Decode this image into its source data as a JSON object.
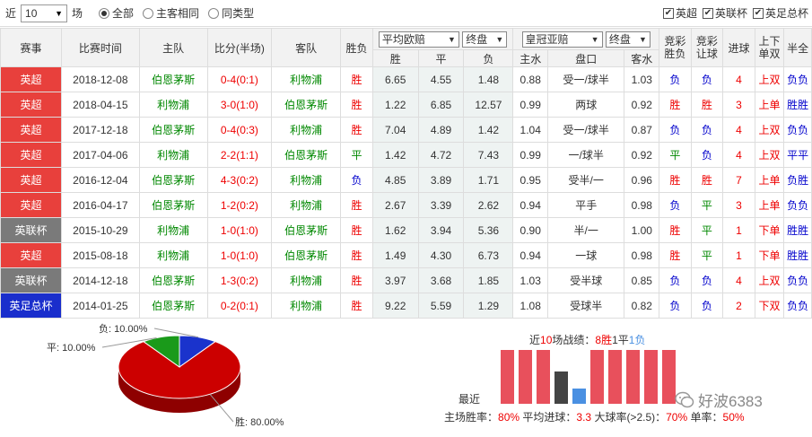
{
  "filter": {
    "prefix": "近",
    "count": "10",
    "suffix": "场",
    "radios": [
      {
        "label": "全部",
        "checked": true
      },
      {
        "label": "主客相同",
        "checked": false
      },
      {
        "label": "同类型",
        "checked": false
      }
    ],
    "checks": [
      {
        "label": "英超",
        "checked": true
      },
      {
        "label": "英联杯",
        "checked": true
      },
      {
        "label": "英足总杯",
        "checked": true
      }
    ],
    "check_mark": "✔"
  },
  "headers": {
    "league": "赛事",
    "time": "比赛时间",
    "home": "主队",
    "score": "比分(半场)",
    "away": "客队",
    "result": "胜负",
    "odds_select": "平均欧赔",
    "odds_type_select": "终盘",
    "asia_select": "皇冠亚赔",
    "asia_type_select": "终盘",
    "lottery_wl": "竞彩胜负",
    "lottery_hc": "竞彩让球",
    "goals": "进球",
    "updown": "上下单双",
    "half": "半全",
    "sub": {
      "win": "胜",
      "draw": "平",
      "lose": "负",
      "home_water": "主水",
      "handicap": "盘口",
      "away_water": "客水"
    }
  },
  "rows": [
    {
      "league": "英超",
      "league_color": "#e8403c",
      "date": "2018-12-08",
      "home": "伯恩茅斯",
      "home_color": "green",
      "score": "0-4(0:1)",
      "away": "利物浦",
      "away_color": "green",
      "result": "胜",
      "result_color": "red",
      "w": "6.65",
      "d": "4.55",
      "l": "1.48",
      "hw": "0.88",
      "hc": "受一/球半",
      "aw": "1.03",
      "lwl": "负",
      "lwl_color": "blue",
      "lhc": "负",
      "lhc_color": "blue",
      "goals": "4",
      "ud": "上双",
      "half": "负负",
      "half_color": "blue"
    },
    {
      "league": "英超",
      "league_color": "#e8403c",
      "date": "2018-04-15",
      "home": "利物浦",
      "home_color": "green",
      "score": "3-0(1:0)",
      "away": "伯恩茅斯",
      "away_color": "green",
      "result": "胜",
      "result_color": "red",
      "w": "1.22",
      "d": "6.85",
      "l": "12.57",
      "hw": "0.99",
      "hc": "两球",
      "aw": "0.92",
      "lwl": "胜",
      "lwl_color": "red",
      "lhc": "胜",
      "lhc_color": "red",
      "goals": "3",
      "ud": "上单",
      "half": "胜胜",
      "half_color": "blue"
    },
    {
      "league": "英超",
      "league_color": "#e8403c",
      "date": "2017-12-18",
      "home": "伯恩茅斯",
      "home_color": "green",
      "score": "0-4(0:3)",
      "away": "利物浦",
      "away_color": "green",
      "result": "胜",
      "result_color": "red",
      "w": "7.04",
      "d": "4.89",
      "l": "1.42",
      "hw": "1.04",
      "hc": "受一/球半",
      "aw": "0.87",
      "lwl": "负",
      "lwl_color": "blue",
      "lhc": "负",
      "lhc_color": "blue",
      "goals": "4",
      "ud": "上双",
      "half": "负负",
      "half_color": "blue"
    },
    {
      "league": "英超",
      "league_color": "#e8403c",
      "date": "2017-04-06",
      "home": "利物浦",
      "home_color": "green",
      "score": "2-2(1:1)",
      "away": "伯恩茅斯",
      "away_color": "green",
      "result": "平",
      "result_color": "green",
      "w": "1.42",
      "d": "4.72",
      "l": "7.43",
      "hw": "0.99",
      "hc": "一/球半",
      "aw": "0.92",
      "lwl": "平",
      "lwl_color": "green",
      "lhc": "负",
      "lhc_color": "blue",
      "goals": "4",
      "ud": "上双",
      "half": "平平",
      "half_color": "blue"
    },
    {
      "league": "英超",
      "league_color": "#e8403c",
      "date": "2016-12-04",
      "home": "伯恩茅斯",
      "home_color": "green",
      "score": "4-3(0:2)",
      "away": "利物浦",
      "away_color": "green",
      "result": "负",
      "result_color": "blue",
      "w": "4.85",
      "d": "3.89",
      "l": "1.71",
      "hw": "0.95",
      "hc": "受半/一",
      "aw": "0.96",
      "lwl": "胜",
      "lwl_color": "red",
      "lhc": "胜",
      "lhc_color": "red",
      "goals": "7",
      "ud": "上单",
      "half": "负胜",
      "half_color": "blue"
    },
    {
      "league": "英超",
      "league_color": "#e8403c",
      "date": "2016-04-17",
      "home": "伯恩茅斯",
      "home_color": "green",
      "score": "1-2(0:2)",
      "away": "利物浦",
      "away_color": "green",
      "result": "胜",
      "result_color": "red",
      "w": "2.67",
      "d": "3.39",
      "l": "2.62",
      "hw": "0.94",
      "hc": "平手",
      "aw": "0.98",
      "lwl": "负",
      "lwl_color": "blue",
      "lhc": "平",
      "lhc_color": "green",
      "goals": "3",
      "ud": "上单",
      "half": "负负",
      "half_color": "blue"
    },
    {
      "league": "英联杯",
      "league_color": "#7a7a7a",
      "date": "2015-10-29",
      "home": "利物浦",
      "home_color": "green",
      "score": "1-0(1:0)",
      "away": "伯恩茅斯",
      "away_color": "green",
      "result": "胜",
      "result_color": "red",
      "w": "1.62",
      "d": "3.94",
      "l": "5.36",
      "hw": "0.90",
      "hc": "半/一",
      "aw": "1.00",
      "lwl": "胜",
      "lwl_color": "red",
      "lhc": "平",
      "lhc_color": "green",
      "goals": "1",
      "ud": "下单",
      "half": "胜胜",
      "half_color": "blue"
    },
    {
      "league": "英超",
      "league_color": "#e8403c",
      "date": "2015-08-18",
      "home": "利物浦",
      "home_color": "green",
      "score": "1-0(1:0)",
      "away": "伯恩茅斯",
      "away_color": "green",
      "result": "胜",
      "result_color": "red",
      "w": "1.49",
      "d": "4.30",
      "l": "6.73",
      "hw": "0.94",
      "hc": "一球",
      "aw": "0.98",
      "lwl": "胜",
      "lwl_color": "red",
      "lhc": "平",
      "lhc_color": "green",
      "goals": "1",
      "ud": "下单",
      "half": "胜胜",
      "half_color": "blue"
    },
    {
      "league": "英联杯",
      "league_color": "#7a7a7a",
      "date": "2014-12-18",
      "home": "伯恩茅斯",
      "home_color": "green",
      "score": "1-3(0:2)",
      "away": "利物浦",
      "away_color": "green",
      "result": "胜",
      "result_color": "red",
      "w": "3.97",
      "d": "3.68",
      "l": "1.85",
      "hw": "1.03",
      "hc": "受半球",
      "aw": "0.85",
      "lwl": "负",
      "lwl_color": "blue",
      "lhc": "负",
      "lhc_color": "blue",
      "goals": "4",
      "ud": "上双",
      "half": "负负",
      "half_color": "blue"
    },
    {
      "league": "英足总杯",
      "league_color": "#1a2ecc",
      "date": "2014-01-25",
      "home": "伯恩茅斯",
      "home_color": "green",
      "score": "0-2(0:1)",
      "away": "利物浦",
      "away_color": "green",
      "result": "胜",
      "result_color": "red",
      "w": "9.22",
      "d": "5.59",
      "l": "1.29",
      "hw": "1.08",
      "hc": "受球半",
      "aw": "0.82",
      "lwl": "负",
      "lwl_color": "blue",
      "lhc": "负",
      "lhc_color": "blue",
      "goals": "2",
      "ud": "下双",
      "half": "负负",
      "half_color": "blue"
    }
  ],
  "pie": {
    "labels": [
      {
        "text": "负: 10.00%"
      },
      {
        "text": "平: 10.00%"
      },
      {
        "text": "胜: 80.00%"
      }
    ],
    "chart_data": {
      "type": "pie",
      "slices": [
        {
          "name": "胜",
          "value": 80,
          "color": "#cc0000"
        },
        {
          "name": "负",
          "value": 10,
          "color": "#1a33cc"
        },
        {
          "name": "平",
          "value": 10,
          "color": "#1a9a1a"
        }
      ]
    }
  },
  "stats": {
    "title_prefix": "近",
    "title_count": "10",
    "title_mid": "场战绩：",
    "wins": "8胜",
    "draws": "1平",
    "losses": "1负",
    "recent_label": "最近",
    "bars": [
      {
        "result": "win",
        "color": "#e8505c"
      },
      {
        "result": "win",
        "color": "#e8505c"
      },
      {
        "result": "win",
        "color": "#e8505c"
      },
      {
        "result": "draw",
        "color": "#444444"
      },
      {
        "result": "loss",
        "color": "#4a90e2"
      },
      {
        "result": "win",
        "color": "#e8505c"
      },
      {
        "result": "win",
        "color": "#e8505c"
      },
      {
        "result": "win",
        "color": "#e8505c"
      },
      {
        "result": "win",
        "color": "#e8505c"
      },
      {
        "result": "win",
        "color": "#e8505c"
      }
    ],
    "line": {
      "win_rate_label": "主场胜率：",
      "win_rate": "80%",
      "avg_goals_label": "平均进球：",
      "avg_goals": "3.3",
      "big_ball_label": "大球率(>2.5)：",
      "big_ball": "70%",
      "odd_label": "单率：",
      "odd": "50%"
    },
    "watermark": "好波6383"
  }
}
